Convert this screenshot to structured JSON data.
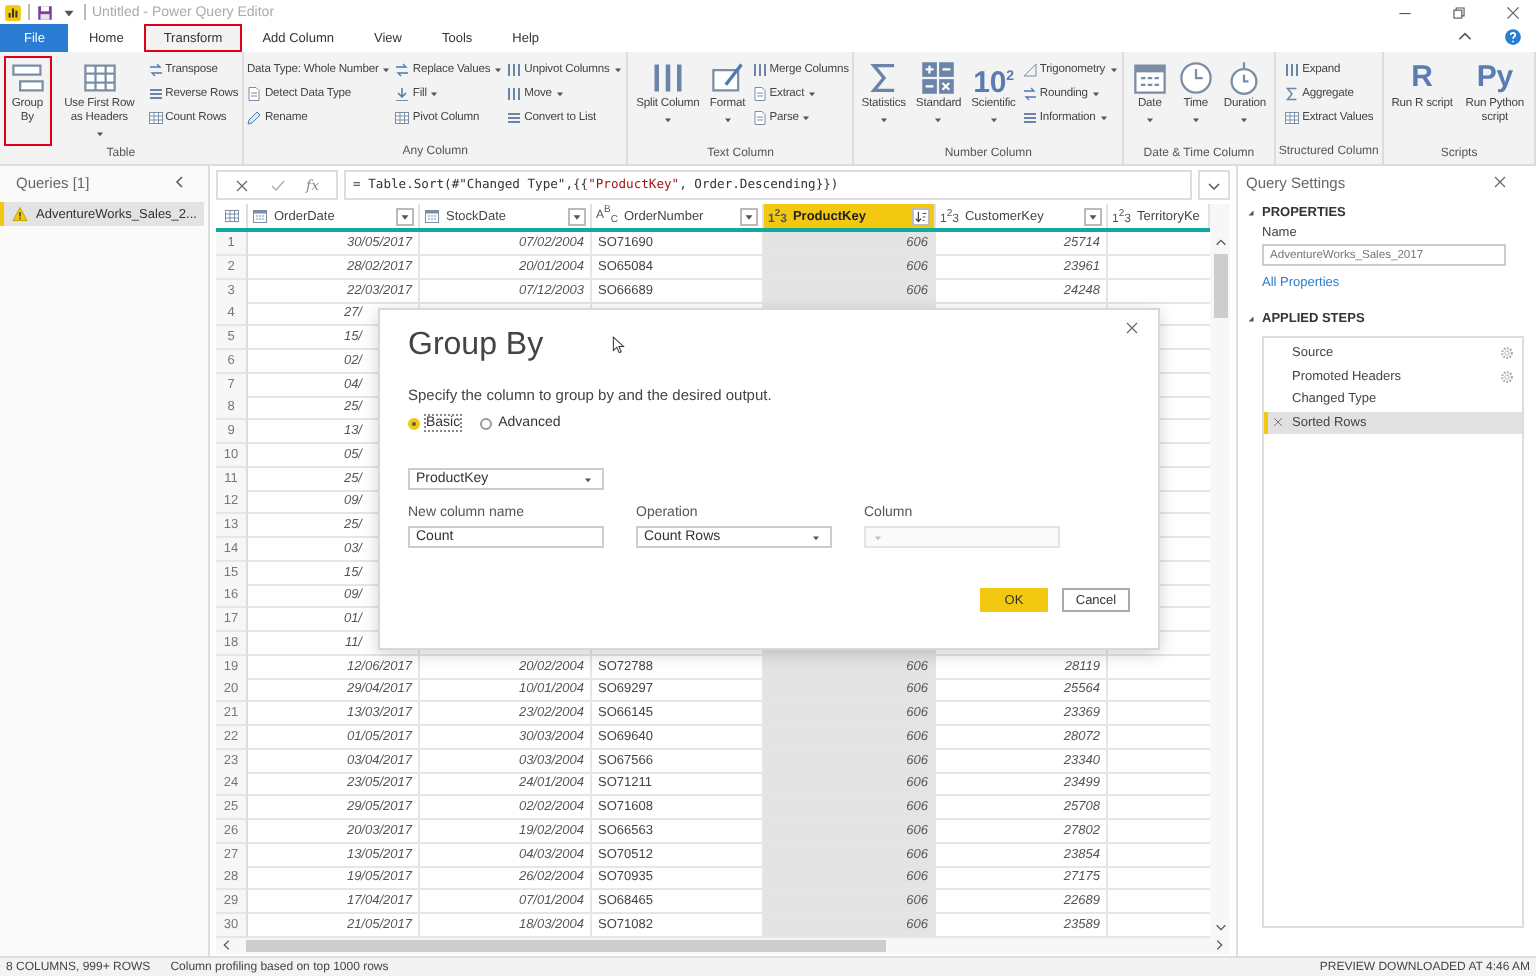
{
  "window": {
    "title": "Untitled - Power Query Editor"
  },
  "ribbon_tabs": [
    {
      "label": "File",
      "kind": "menu",
      "selected": false,
      "highlighted": false
    },
    {
      "label": "Home",
      "kind": "tab",
      "selected": false,
      "highlighted": false
    },
    {
      "label": "Transform",
      "kind": "tab",
      "selected": true,
      "highlighted": true
    },
    {
      "label": "Add Column",
      "kind": "tab",
      "selected": false,
      "highlighted": false
    },
    {
      "label": "View",
      "kind": "tab",
      "selected": false,
      "highlighted": false
    },
    {
      "label": "Tools",
      "kind": "tab",
      "selected": false,
      "highlighted": false
    },
    {
      "label": "Help",
      "kind": "tab",
      "selected": false,
      "highlighted": false
    }
  ],
  "ribbon_groups": [
    {
      "label": "Table",
      "items": [
        {
          "kind": "large",
          "label": "Group By",
          "dropdown": false,
          "highlighted": true
        },
        {
          "kind": "large",
          "label": "Use First Row as Headers",
          "dropdown": true,
          "highlighted": false
        },
        {
          "kind": "stack",
          "buttons": [
            {
              "label": "Transpose",
              "dropdown": false
            },
            {
              "label": "Reverse Rows",
              "dropdown": false
            },
            {
              "label": "Count Rows",
              "dropdown": false
            }
          ]
        }
      ]
    },
    {
      "label": "Any Column",
      "items": [
        {
          "kind": "stack",
          "buttons": [
            {
              "label": "Data Type: Whole Number",
              "dropdown": true
            },
            {
              "label": "Detect Data Type",
              "dropdown": false
            },
            {
              "label": "Rename",
              "dropdown": false
            }
          ]
        },
        {
          "kind": "stack",
          "buttons": [
            {
              "label": "Replace Values",
              "dropdown": true
            },
            {
              "label": "Fill",
              "dropdown": true
            },
            {
              "label": "Pivot Column",
              "dropdown": false
            }
          ]
        },
        {
          "kind": "stack",
          "buttons": [
            {
              "label": "Unpivot Columns",
              "dropdown": true
            },
            {
              "label": "Move",
              "dropdown": true
            },
            {
              "label": "Convert to List",
              "dropdown": false
            }
          ]
        }
      ]
    },
    {
      "label": "Text Column",
      "items": [
        {
          "kind": "large",
          "label": "Split Column",
          "dropdown": true,
          "highlighted": false
        },
        {
          "kind": "large",
          "label": "Format",
          "dropdown": true,
          "highlighted": false
        },
        {
          "kind": "stack",
          "buttons": [
            {
              "label": "Merge Columns",
              "dropdown": false
            },
            {
              "label": "Extract",
              "dropdown": true
            },
            {
              "label": "Parse",
              "dropdown": true
            }
          ]
        }
      ]
    },
    {
      "label": "Number Column",
      "items": [
        {
          "kind": "large",
          "label": "Statistics",
          "dropdown": true,
          "highlighted": false
        },
        {
          "kind": "large",
          "label": "Standard",
          "dropdown": true,
          "highlighted": false
        },
        {
          "kind": "large",
          "label": "Scientific",
          "glyph": "10$^{2}$",
          "dropdown": true,
          "highlighted": false
        },
        {
          "kind": "stack",
          "buttons": [
            {
              "label": "Trigonometry",
              "dropdown": true
            },
            {
              "label": "Rounding",
              "dropdown": true
            },
            {
              "label": "Information",
              "dropdown": true
            }
          ]
        }
      ]
    },
    {
      "label": "Date & Time Column",
      "items": [
        {
          "kind": "large",
          "label": "Date",
          "dropdown": true,
          "highlighted": false
        },
        {
          "kind": "large",
          "label": "Time",
          "dropdown": true,
          "highlighted": false
        },
        {
          "kind": "large",
          "label": "Duration",
          "dropdown": true,
          "highlighted": false
        }
      ]
    },
    {
      "label": "Structured Column",
      "items": [
        {
          "kind": "stack",
          "buttons": [
            {
              "label": "Expand",
              "dropdown": false
            },
            {
              "label": "Aggregate",
              "dropdown": false
            },
            {
              "label": "Extract Values",
              "dropdown": false
            }
          ]
        }
      ]
    },
    {
      "label": "Scripts",
      "items": [
        {
          "kind": "large",
          "label": "Run R script",
          "glyph": "R",
          "dropdown": false,
          "highlighted": false
        },
        {
          "kind": "large",
          "label": "Run Python script",
          "glyph": "Py",
          "dropdown": false,
          "highlighted": false
        }
      ]
    }
  ],
  "queries_pane": {
    "title": "Queries [1]",
    "items": [
      {
        "label": "AdventureWorks_Sales_2...",
        "selected": true,
        "warning": true
      }
    ]
  },
  "formula_bar": {
    "fx_label": "fx",
    "segments": [
      {
        "kind": "code",
        "text": "= Table.Sort(#\"Changed Type\",{{"
      },
      {
        "kind": "string",
        "text": "\"ProductKey\""
      },
      {
        "kind": "code",
        "text": ", Order.Descending}})"
      }
    ]
  },
  "table": {
    "columns": [
      {
        "name": "OrderDate",
        "kind": "date",
        "selected": false,
        "sorted_descending": false
      },
      {
        "name": "StockDate",
        "kind": "date",
        "selected": false,
        "sorted_descending": false
      },
      {
        "name": "OrderNumber",
        "kind": "text",
        "type_label": "A$^{B}$$_{C}$",
        "selected": false,
        "sorted_descending": false
      },
      {
        "name": "ProductKey",
        "kind": "number",
        "type_label": "1$^{2}$3",
        "selected": true,
        "sorted_descending": true
      },
      {
        "name": "CustomerKey",
        "kind": "number",
        "type_label": "1$^{2}$3",
        "selected": false,
        "sorted_descending": false
      },
      {
        "name": "TerritoryKe",
        "kind": "number",
        "type_label": "1$^{2}$3",
        "selected": false
      }
    ],
    "rows": [
      {
        "number": "1",
        "cells": [
          "30/05/2017",
          "07/02/2004",
          "SO71690",
          "606",
          "25714"
        ]
      },
      {
        "number": "2",
        "cells": [
          "28/02/2017",
          "20/01/2004",
          "SO65084",
          "606",
          "23961"
        ]
      },
      {
        "number": "3",
        "cells": [
          "22/03/2017",
          "07/12/2003",
          "SO66689",
          "606",
          "24248"
        ]
      },
      {
        "number": "4",
        "cells": [
          "27/"
        ]
      },
      {
        "number": "5",
        "cells": [
          "15/"
        ]
      },
      {
        "number": "6",
        "cells": [
          "02/"
        ]
      },
      {
        "number": "7",
        "cells": [
          "04/"
        ]
      },
      {
        "number": "8",
        "cells": [
          "25/"
        ]
      },
      {
        "number": "9",
        "cells": [
          "13/"
        ]
      },
      {
        "number": "10",
        "cells": [
          "05/"
        ]
      },
      {
        "number": "11",
        "cells": [
          "25/"
        ]
      },
      {
        "number": "12",
        "cells": [
          "09/"
        ]
      },
      {
        "number": "13",
        "cells": [
          "25/"
        ]
      },
      {
        "number": "14",
        "cells": [
          "03/"
        ]
      },
      {
        "number": "15",
        "cells": [
          "15/"
        ]
      },
      {
        "number": "16",
        "cells": [
          "09/"
        ]
      },
      {
        "number": "17",
        "cells": [
          "01/"
        ]
      },
      {
        "number": "18",
        "cells": [
          "11/"
        ]
      },
      {
        "number": "19",
        "cells": [
          "12/06/2017",
          "20/02/2004",
          "SO72788",
          "606",
          "28119"
        ]
      },
      {
        "number": "20",
        "cells": [
          "29/04/2017",
          "10/01/2004",
          "SO69297",
          "606",
          "25564"
        ]
      },
      {
        "number": "21",
        "cells": [
          "13/03/2017",
          "23/02/2004",
          "SO66145",
          "606",
          "23369"
        ]
      },
      {
        "number": "22",
        "cells": [
          "01/05/2017",
          "30/03/2004",
          "SO69640",
          "606",
          "28072"
        ]
      },
      {
        "number": "23",
        "cells": [
          "03/04/2017",
          "03/03/2004",
          "SO67566",
          "606",
          "23340"
        ]
      },
      {
        "number": "24",
        "cells": [
          "23/05/2017",
          "24/01/2004",
          "SO71211",
          "606",
          "23499"
        ]
      },
      {
        "number": "25",
        "cells": [
          "29/05/2017",
          "02/02/2004",
          "SO71608",
          "606",
          "25708"
        ]
      },
      {
        "number": "26",
        "cells": [
          "20/03/2017",
          "19/02/2004",
          "SO66563",
          "606",
          "27802"
        ]
      },
      {
        "number": "27",
        "cells": [
          "13/05/2017",
          "04/03/2004",
          "SO70512",
          "606",
          "23854"
        ]
      },
      {
        "number": "28",
        "cells": [
          "19/05/2017",
          "26/02/2004",
          "SO70935",
          "606",
          "27175"
        ]
      },
      {
        "number": "29",
        "cells": [
          "17/04/2017",
          "07/01/2004",
          "SO68465",
          "606",
          "22689"
        ]
      },
      {
        "number": "30",
        "cells": [
          "21/05/2017",
          "18/03/2004",
          "SO71082",
          "606",
          "23589"
        ]
      }
    ]
  },
  "dialog": {
    "title": "Group By",
    "description": "Specify the column to group by and the desired output.",
    "modes": [
      {
        "label": "Basic",
        "selected": true
      },
      {
        "label": "Advanced",
        "selected": false
      }
    ],
    "group_column": "ProductKey",
    "fields": [
      {
        "label": "New column name",
        "kind": "text",
        "value": "Count",
        "disabled": false
      },
      {
        "label": "Operation",
        "kind": "dropdown",
        "value": "Count Rows",
        "disabled": false
      },
      {
        "label": "Column",
        "kind": "dropdown",
        "disabled": true
      }
    ],
    "buttons": [
      {
        "label": "OK",
        "kind": "primary"
      },
      {
        "label": "Cancel",
        "kind": "secondary"
      }
    ]
  },
  "settings_pane": {
    "title": "Query Settings",
    "properties_heading": "PROPERTIES",
    "name_label": "Name",
    "name_value": "AdventureWorks_Sales_2017",
    "link": "All Properties",
    "steps_heading": "APPLIED STEPS",
    "steps": [
      {
        "label": "Source",
        "settings": true,
        "selected": false
      },
      {
        "label": "Promoted Headers",
        "settings": true,
        "selected": false
      },
      {
        "label": "Changed Type",
        "settings": false,
        "selected": false
      },
      {
        "label": "Sorted Rows",
        "settings": false,
        "selected": true
      }
    ]
  },
  "status_bar": {
    "left": [
      "8 COLUMNS, 999+ ROWS",
      "Column profiling based on top 1000 rows"
    ],
    "right": "PREVIEW DOWNLOADED AT 4:46 AM"
  }
}
